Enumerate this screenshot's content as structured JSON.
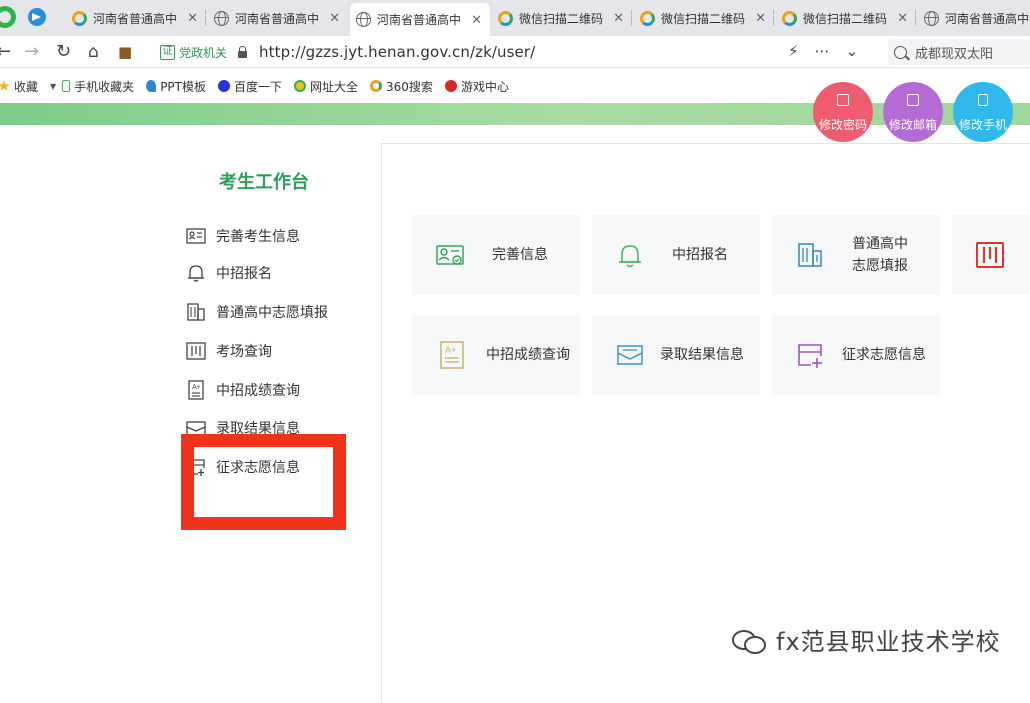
{
  "browser": {
    "tabs": [
      {
        "title": "河南省普通高中",
        "icon": "globe-o-icon"
      },
      {
        "title": "河南省普通高中",
        "icon": "globe-icon"
      },
      {
        "title": "河南省普通高中",
        "icon": "globe-icon",
        "active": true
      },
      {
        "title": "微信扫描二维码",
        "icon": "globe-o-icon"
      },
      {
        "title": "微信扫描二维码",
        "icon": "globe-o-icon"
      },
      {
        "title": "微信扫描二维码",
        "icon": "globe-o-icon"
      },
      {
        "title": "河南省普通高中",
        "icon": "globe-icon"
      }
    ],
    "close_glyph": "×",
    "cert_badge": "证",
    "cert_label": "党政机关",
    "url": "http://gzzs.jyt.henan.gov.cn/zk/user/",
    "search_text": "成都现双太阳",
    "bookmarks": [
      "收藏",
      "手机收藏夹",
      "PPT模板",
      "百度一下",
      "网址大全",
      "360搜索",
      "游戏中心"
    ]
  },
  "top_actions": [
    {
      "label": "修改密码",
      "color": "#ee5d6f"
    },
    {
      "label": "修改邮箱",
      "color": "#b46bd6"
    },
    {
      "label": "修改手机",
      "color": "#2fb8ea"
    }
  ],
  "sidebar": {
    "title": "考生工作台",
    "items": [
      {
        "label": "完善考生信息",
        "icon": "id-card-icon"
      },
      {
        "label": "中招报名",
        "icon": "bell-icon"
      },
      {
        "label": "普通高中志愿填报",
        "icon": "building-icon"
      },
      {
        "label": "考场查询",
        "icon": "columns-icon"
      },
      {
        "label": "中招成绩查询",
        "icon": "score-sheet-icon"
      },
      {
        "label": "录取结果信息",
        "icon": "envelope-icon"
      },
      {
        "label": "征求志愿信息",
        "icon": "form-plus-icon"
      }
    ]
  },
  "cards": [
    {
      "label": "完善信息",
      "icon": "id-card-icon",
      "color": "#35a35f"
    },
    {
      "label": "中招报名",
      "icon": "bell-icon",
      "color": "#45b05a"
    },
    {
      "label": "普通高中志愿填报",
      "label_lines": [
        "普通高中",
        "志愿填报"
      ],
      "icon": "building-icon",
      "color": "#2f86c8"
    },
    {
      "label": "",
      "icon": "columns-icon",
      "color": "#d8392b"
    },
    {
      "label": "中招成绩查询",
      "icon": "score-sheet-icon",
      "color": "#c9b26a"
    },
    {
      "label": "录取结果信息",
      "icon": "envelope-icon",
      "color": "#3c8fd0"
    },
    {
      "label": "征求志愿信息",
      "icon": "form-plus-icon",
      "color": "#9b59b6"
    }
  ],
  "watermark": "fx范县职业技术学校"
}
